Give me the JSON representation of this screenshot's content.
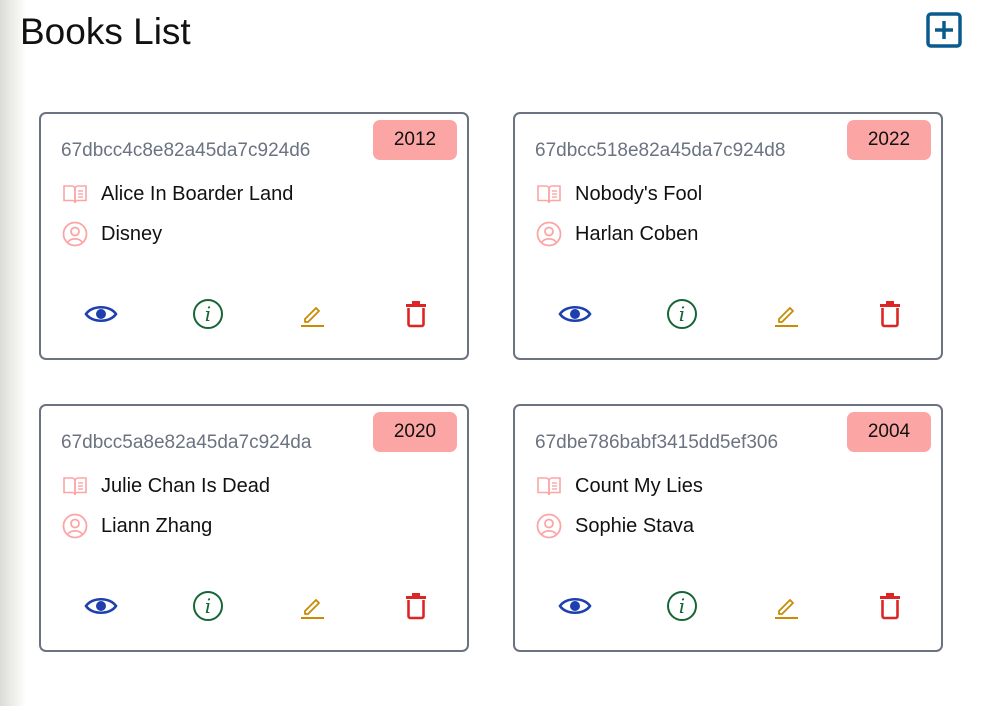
{
  "header": {
    "title": "Books List",
    "add_icon": "plus-square-icon"
  },
  "colors": {
    "badge_bg": "#fca5a5",
    "view": "#1e40af",
    "info": "#166534",
    "edit": "#ca8a04",
    "delete": "#dc2626",
    "row_icon": "#fca5a5",
    "id_text": "#6b7280"
  },
  "books": [
    {
      "id": "67dbcc4c8e82a45da7c924d6",
      "year": "2012",
      "title": "Alice In Boarder Land",
      "author": "Disney"
    },
    {
      "id": "67dbcc518e82a45da7c924d8",
      "year": "2022",
      "title": "Nobody's Fool",
      "author": "Harlan Coben"
    },
    {
      "id": "67dbcc5a8e82a45da7c924da",
      "year": "2020",
      "title": "Julie Chan Is Dead",
      "author": "Liann Zhang"
    },
    {
      "id": "67dbe786babf3415dd5ef306",
      "year": "2004",
      "title": "Count My Lies",
      "author": "Sophie Stava"
    }
  ],
  "actions": {
    "view_icon": "eye-icon",
    "info_icon": "info-circle-icon",
    "edit_icon": "pencil-icon",
    "delete_icon": "trash-icon"
  }
}
